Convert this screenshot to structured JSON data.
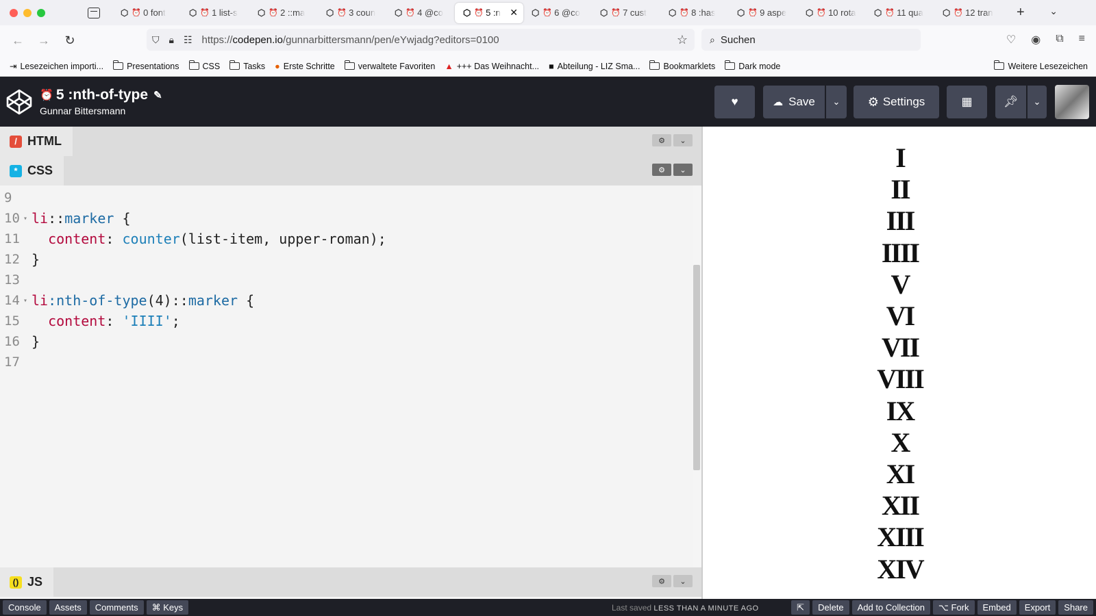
{
  "browser": {
    "tabs": [
      {
        "label": "0 font"
      },
      {
        "label": "1 list-s"
      },
      {
        "label": "2 ::ma"
      },
      {
        "label": "3 coun"
      },
      {
        "label": "4 @co"
      },
      {
        "label": "5 :n",
        "active": true
      },
      {
        "label": "6 @co"
      },
      {
        "label": "7 cust"
      },
      {
        "label": "8 :has"
      },
      {
        "label": "9 aspe"
      },
      {
        "label": "10 rota"
      },
      {
        "label": "11 qua"
      },
      {
        "label": "12 tran"
      }
    ],
    "url_prefix": "https://",
    "url_host": "codepen.io",
    "url_path": "/gunnarbittersmann/pen/eYwjadg?editors=0100",
    "search_placeholder": "Suchen",
    "bookmarks": [
      "Lesezeichen importi...",
      "Presentations",
      "CSS",
      "Tasks",
      "Erste Schritte",
      "verwaltete Favoriten",
      "+++ Das Weihnacht...",
      "Abteilung - LIZ Sma...",
      "Bookmarklets",
      "Dark mode"
    ],
    "bookmarks_more": "Weitere Lesezeichen"
  },
  "header": {
    "title": "5 :nth-of-type",
    "author": "Gunnar Bittersmann",
    "save_label": "Save",
    "settings_label": "Settings"
  },
  "editors": {
    "html_label": "HTML",
    "css_label": "CSS",
    "js_label": "JS",
    "code_lines": [
      {
        "n": "9",
        "t": ""
      },
      {
        "n": "10",
        "t": "li::marker {"
      },
      {
        "n": "11",
        "t": "  content: counter(list-item, upper-roman);"
      },
      {
        "n": "12",
        "t": "}"
      },
      {
        "n": "13",
        "t": ""
      },
      {
        "n": "14",
        "t": "li:nth-of-type(4)::marker {"
      },
      {
        "n": "15",
        "t": "  content: 'IIII';"
      },
      {
        "n": "16",
        "t": "}"
      },
      {
        "n": "17",
        "t": ""
      }
    ]
  },
  "preview": {
    "numerals": [
      "I",
      "II",
      "III",
      "IIII",
      "V",
      "VI",
      "VII",
      "VIII",
      "IX",
      "X",
      "XI",
      "XII",
      "XIII",
      "XIV"
    ]
  },
  "footer": {
    "left_buttons": [
      "Console",
      "Assets",
      "Comments",
      "⌘ Keys"
    ],
    "saved_prefix": "Last saved",
    "saved_time": "LESS THAN A MINUTE AGO",
    "right_buttons": [
      "Delete",
      "Add to Collection",
      "⌥ Fork",
      "Embed",
      "Export",
      "Share"
    ]
  },
  "colors": {
    "codepen_dark": "#1e1f26",
    "button_gray": "#444857",
    "html_badge": "#e44d3a",
    "css_badge": "#15b2e4",
    "js_badge": "#f7df1e"
  }
}
